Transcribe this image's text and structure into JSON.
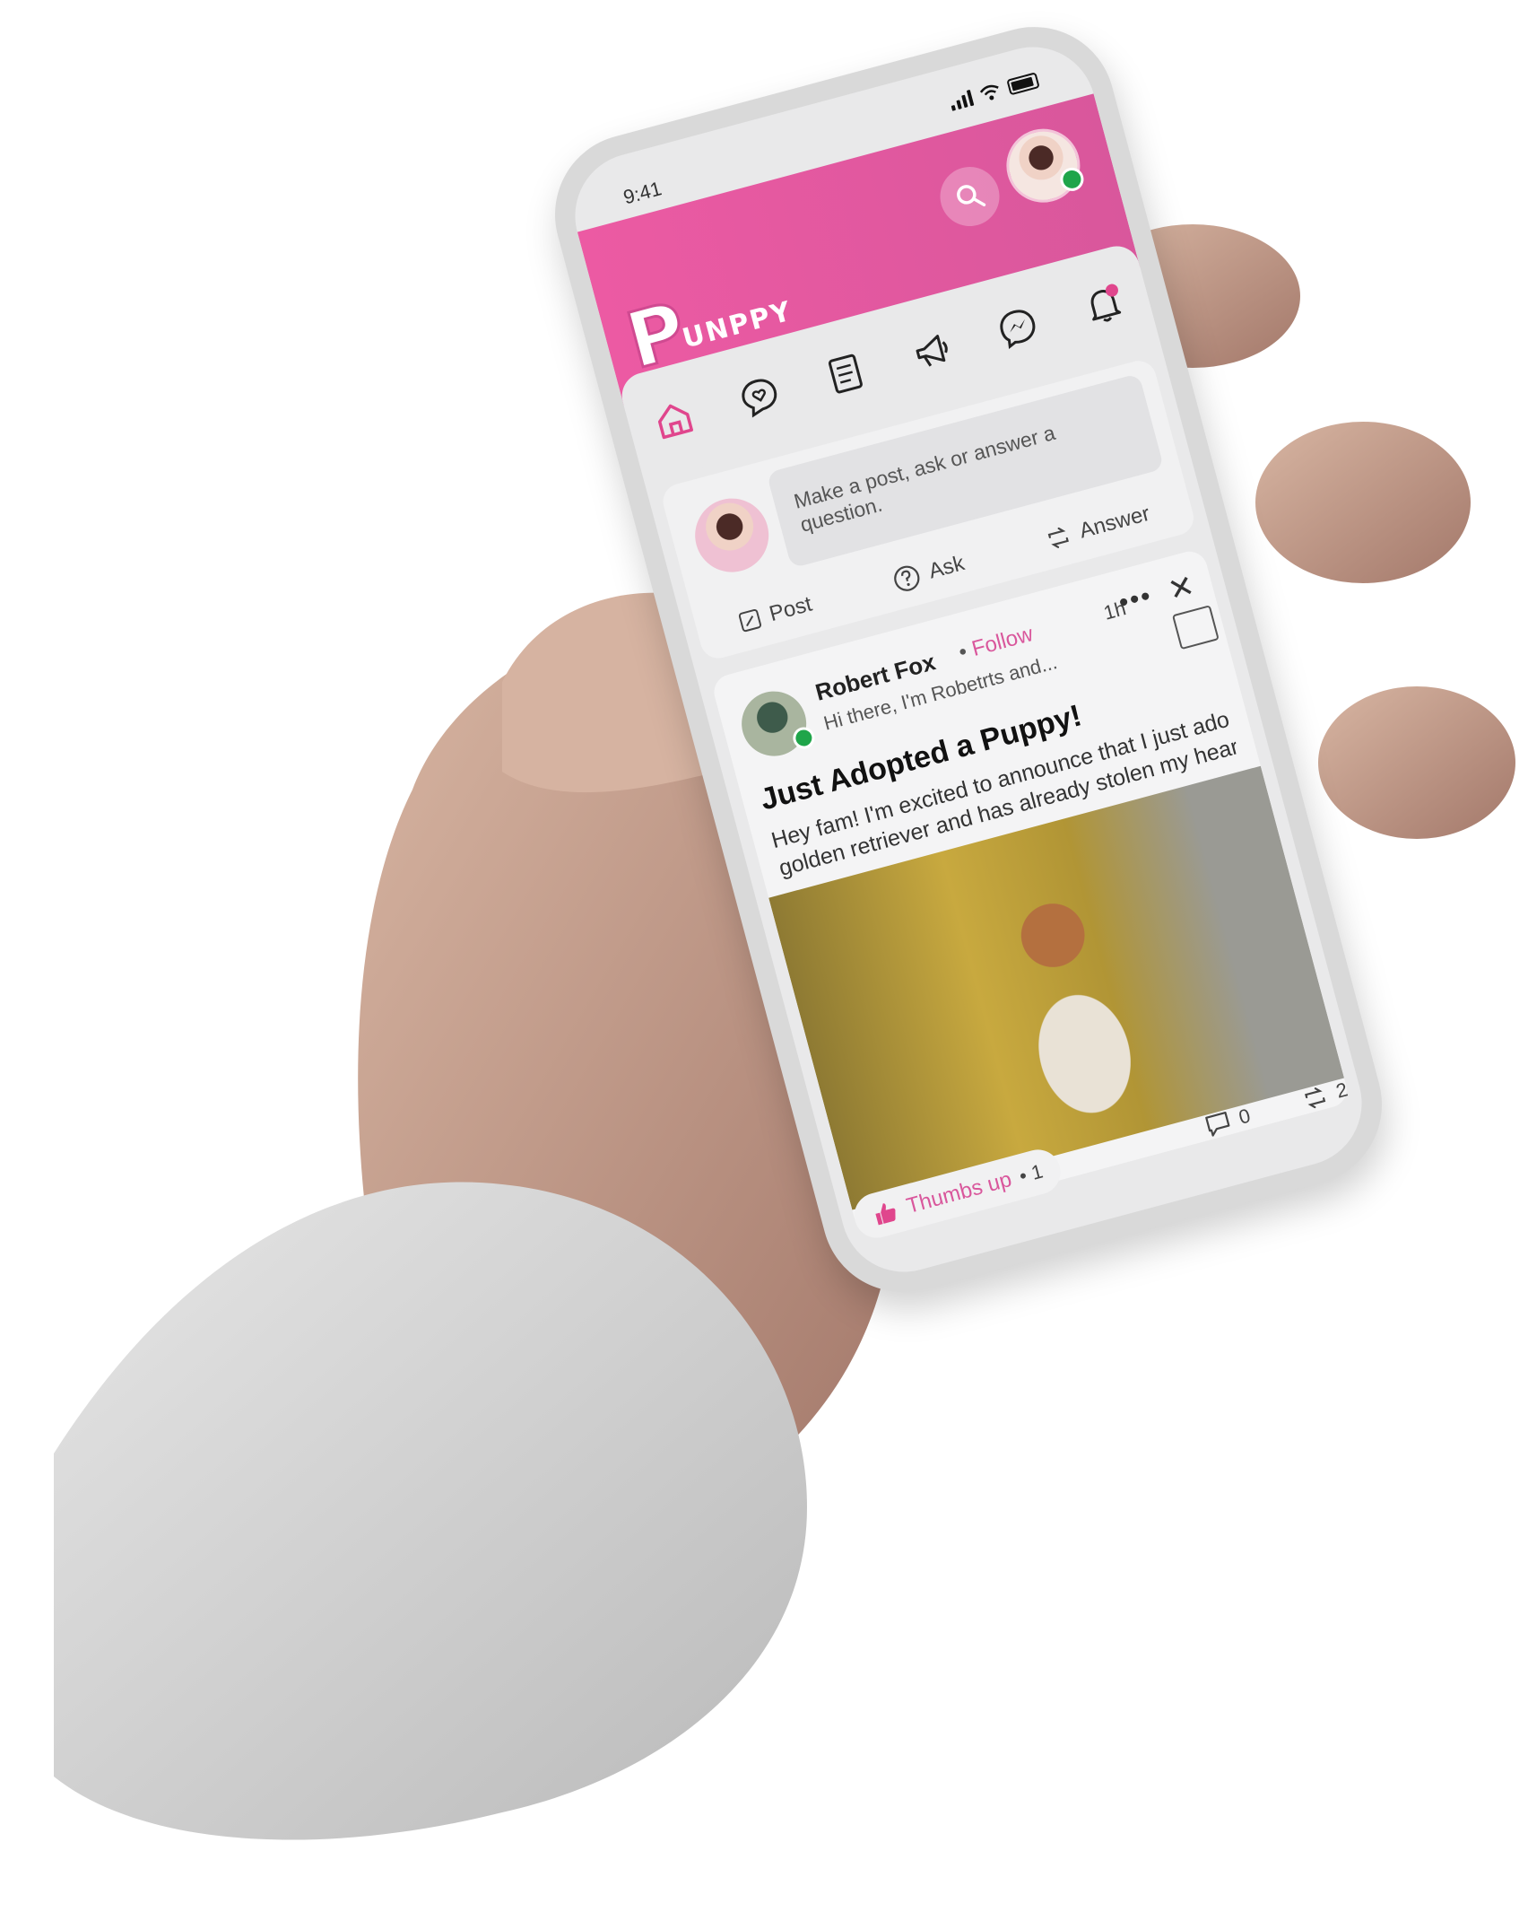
{
  "status_bar": {
    "time": "9:41"
  },
  "app": {
    "logo_letter": "P",
    "logo_text": "UNPPY",
    "brand_color": "#e0468d",
    "online_color": "#1fa54a"
  },
  "nav": {
    "items": [
      {
        "icon": "home-icon"
      },
      {
        "icon": "chat-heart-icon"
      },
      {
        "icon": "document-icon"
      },
      {
        "icon": "megaphone-icon"
      },
      {
        "icon": "messenger-icon"
      },
      {
        "icon": "bell-icon"
      }
    ]
  },
  "composer": {
    "placeholder": "Make a post, ask or answer a question.",
    "actions": {
      "ask": "Ask",
      "answer": "Answer",
      "post": "Post"
    }
  },
  "post": {
    "author": "Robert Fox",
    "follow": "Follow",
    "bio": "Hi there, I'm Robetrts and...",
    "time_ago": "1h",
    "title": "Just Adopted a Puppy!",
    "body_line1": "Hey fam! I'm excited to announce that I just adop",
    "body_line2": "golden retriever and has already stolen my heart",
    "reactions": {
      "thumbs_label": "Thumbs up",
      "thumbs_count": "1",
      "comments": "0",
      "reposts": "2"
    }
  },
  "separator": "•"
}
